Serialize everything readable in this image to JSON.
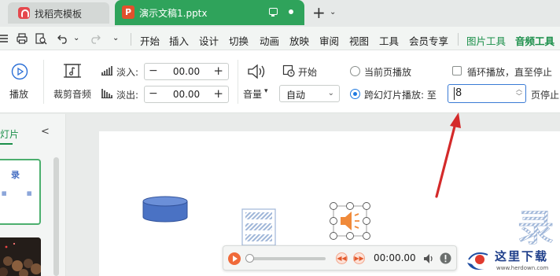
{
  "tabs": [
    {
      "label": "找稻壳模板"
    },
    {
      "label": "演示文稿1.pptx",
      "icon_letter": "P"
    }
  ],
  "menu": {
    "items": [
      "开始",
      "插入",
      "设计",
      "切换",
      "动画",
      "放映",
      "审阅",
      "视图",
      "工具",
      "会员专享"
    ],
    "context_tabs": [
      "图片工具",
      "音频工具"
    ],
    "active": "音频工具"
  },
  "ribbon": {
    "play_label": "播放",
    "trim_label": "裁剪音频",
    "fade_in_label": "淡入:",
    "fade_in_value": "00.00",
    "fade_out_label": "淡出:",
    "fade_out_value": "00.00",
    "volume_label": "音量",
    "start_label": "开始",
    "start_value": "自动",
    "radio_current": "当前页播放",
    "radio_across": "跨幻灯片播放: 至",
    "loop_label": "循环播放，直至停止",
    "stop_value": "8",
    "stop_suffix": "页停止"
  },
  "left_panel": {
    "title_fragment": "灯片",
    "collapse_glyph": "<",
    "thumb_char": "录"
  },
  "media_bar": {
    "time": "00:00.00"
  },
  "slide": {
    "art_char": "录"
  },
  "watermark": {
    "site": "这里下载",
    "url": "www.herdown.com"
  },
  "colors": {
    "accent_green": "#2fa35b",
    "active_menu": "#1b8f4a",
    "arrow_red": "#d42a2a",
    "audio_orange": "#f08a3a",
    "shape_blue": "#4a72c4"
  }
}
